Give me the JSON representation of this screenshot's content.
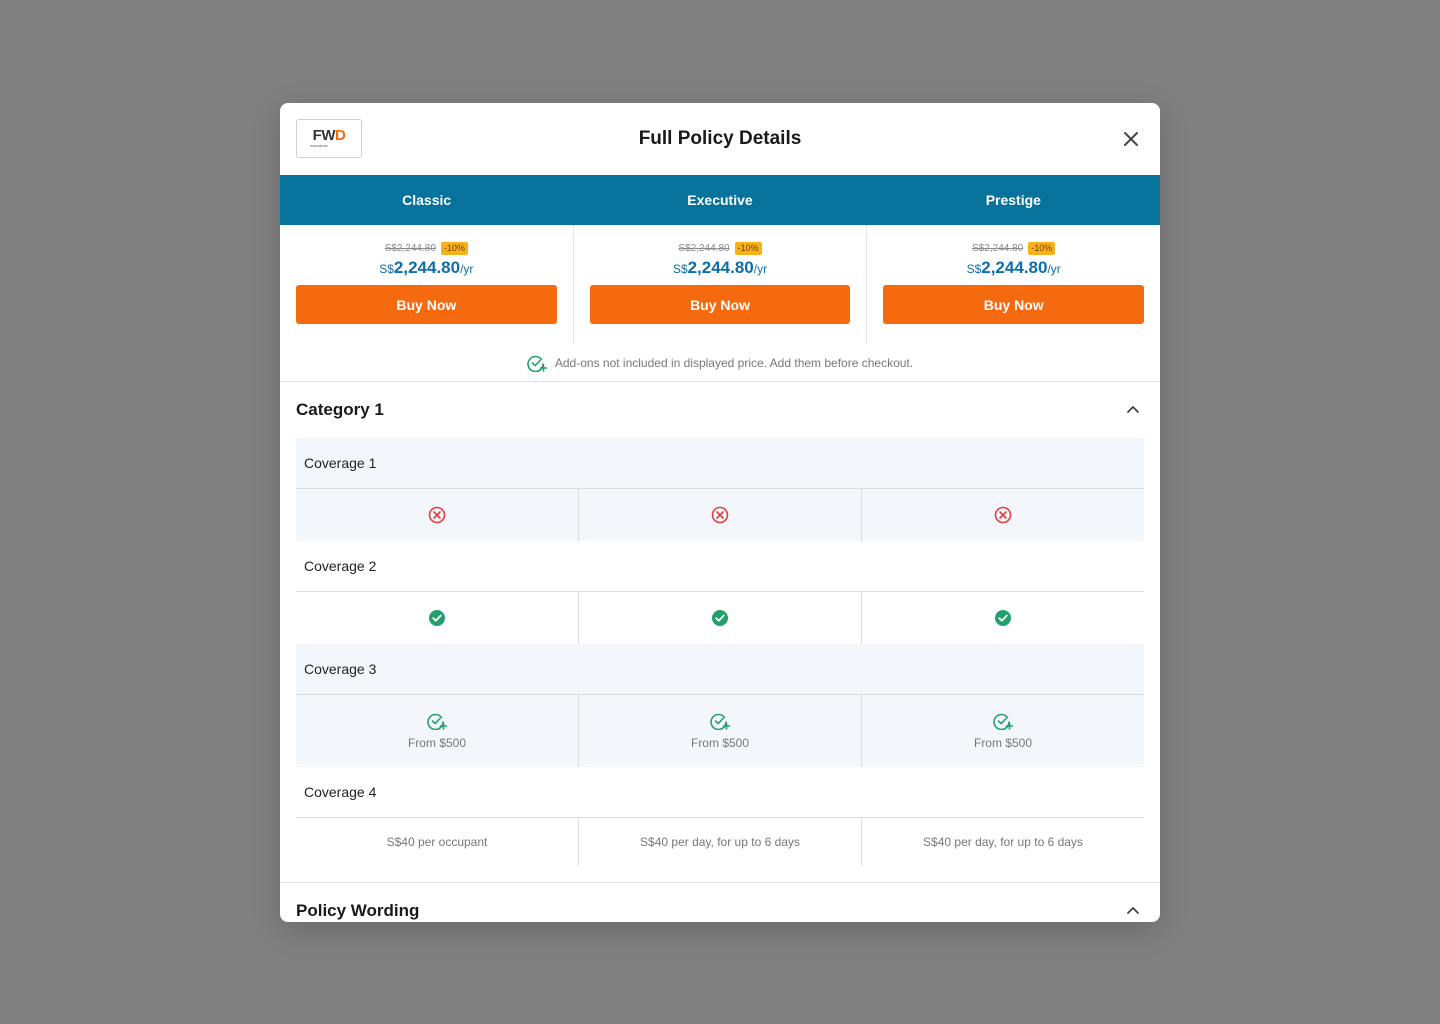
{
  "modal": {
    "title": "Full Policy Details",
    "logo": {
      "text": "FWD",
      "subtext": "insurance"
    }
  },
  "colors": {
    "plan_bar": "#07729b",
    "buy_button": "#f5690f",
    "price": "#0b6fae",
    "discount_badge": "#f7b21b",
    "check_green": "#22a06b",
    "cross_red": "#e0403a"
  },
  "plans": [
    {
      "name": "Classic",
      "original_price": "S$2,244.80",
      "discount": "-10%",
      "currency": "S$",
      "price": "2,244.80",
      "period": "/yr",
      "buy_label": "Buy Now"
    },
    {
      "name": "Executive",
      "original_price": "S$2,244.80",
      "discount": "-10%",
      "currency": "S$",
      "price": "2,244.80",
      "period": "/yr",
      "buy_label": "Buy Now"
    },
    {
      "name": "Prestige",
      "original_price": "S$2,244.80",
      "discount": "-10%",
      "currency": "S$",
      "price": "2,244.80",
      "period": "/yr",
      "buy_label": "Buy Now"
    }
  ],
  "addon_note": {
    "icon": "check-plus-icon",
    "text": "Add-ons not included in displayed price. Add them before checkout."
  },
  "category": {
    "title": "Category 1",
    "toggle_icon": "chevron-up-icon",
    "coverages": [
      {
        "label": "Coverage 1",
        "values": [
          {
            "icon": "cross-circle-icon"
          },
          {
            "icon": "cross-circle-icon"
          },
          {
            "icon": "cross-circle-icon"
          }
        ]
      },
      {
        "label": "Coverage 2",
        "values": [
          {
            "icon": "check-circle-icon"
          },
          {
            "icon": "check-circle-icon"
          },
          {
            "icon": "check-circle-icon"
          }
        ]
      },
      {
        "label": "Coverage 3",
        "values": [
          {
            "icon": "check-plus-icon",
            "text": "From $500"
          },
          {
            "icon": "check-plus-icon",
            "text": "From $500"
          },
          {
            "icon": "check-plus-icon",
            "text": "From $500"
          }
        ]
      },
      {
        "label": "Coverage 4",
        "values": [
          {
            "text": "S$40 per occupant"
          },
          {
            "text": "S$40 per day, for up to 6 days"
          },
          {
            "text": "S$40 per day, for up to 6 days"
          }
        ]
      }
    ]
  },
  "policy_wording": {
    "title": "Policy Wording",
    "toggle_icon": "chevron-up-icon"
  }
}
